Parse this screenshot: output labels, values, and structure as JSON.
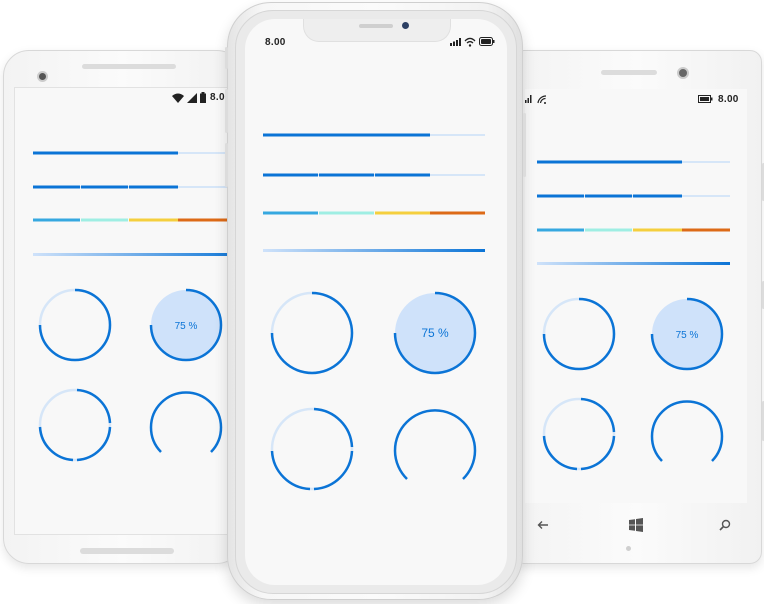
{
  "android": {
    "time": "8.00"
  },
  "iphone": {
    "time": "8.00"
  },
  "windows": {
    "time": "8.00"
  },
  "ring_label": "75 %",
  "colors": {
    "accent": "#0b74d6",
    "track": "#d6e6f8",
    "fill_light": "#cfe2fa",
    "seg_1": "#36a8e0",
    "seg_2": "#9feee3",
    "seg_3": "#f5cf3e",
    "seg_4": "#dd6a17"
  },
  "progress": {
    "linear_determinate": 0.75,
    "linear_segmented": 0.75,
    "circular_determinate": 0.75,
    "circular_filled": 0.75
  }
}
